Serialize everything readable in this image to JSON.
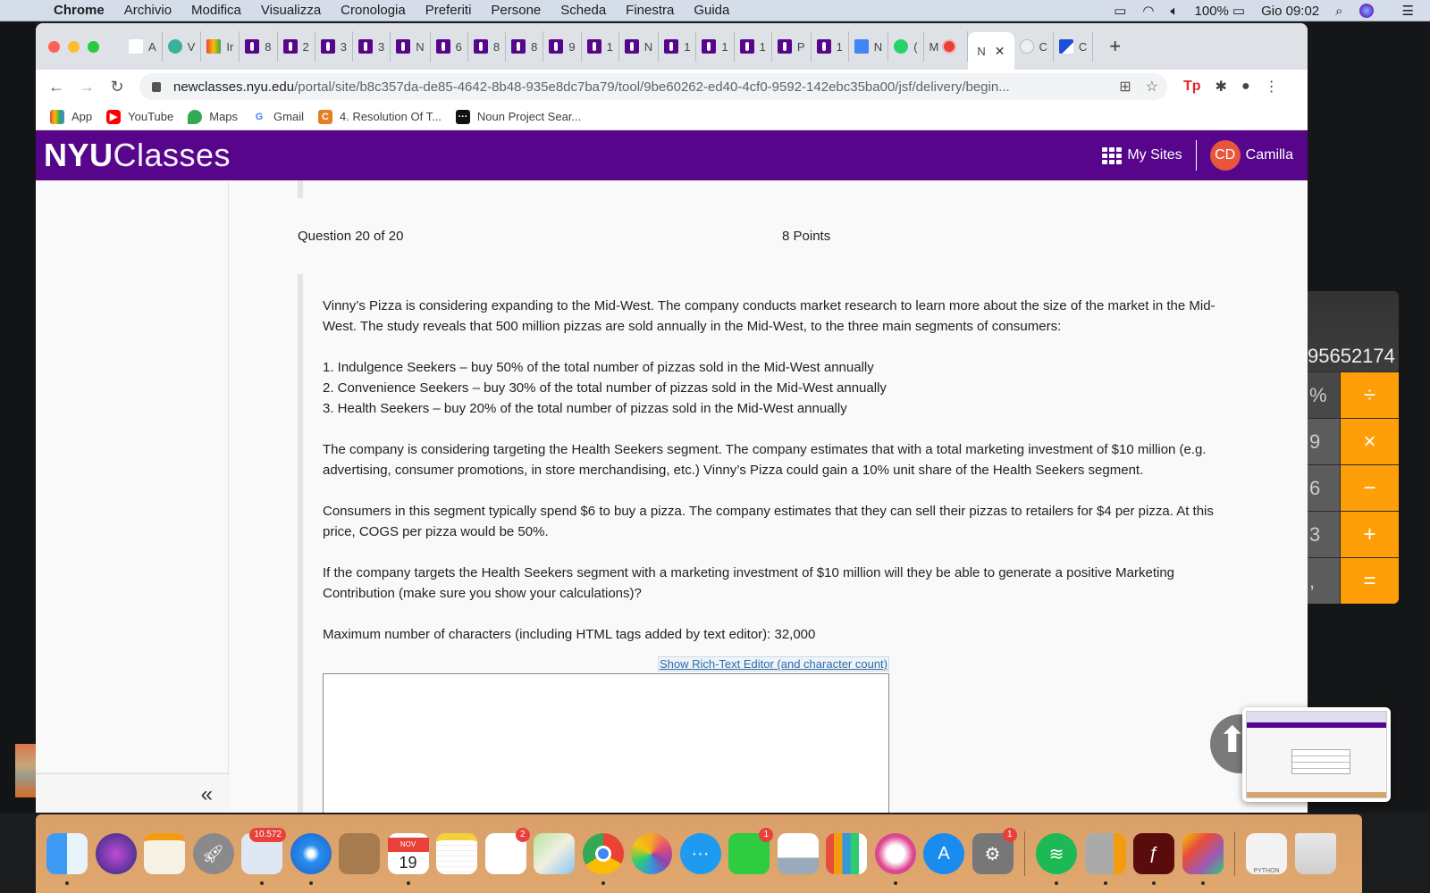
{
  "menubar": {
    "app": "Chrome",
    "items": [
      "Archivio",
      "Modifica",
      "Visualizza",
      "Cronologia",
      "Preferiti",
      "Persone",
      "Scheda",
      "Finestra",
      "Guida"
    ],
    "battery": "100%",
    "clock": "Gio 09:02"
  },
  "tabs": [
    {
      "label": "A",
      "icon": "shoe-icon"
    },
    {
      "label": "V",
      "icon": "play-icon"
    },
    {
      "label": "Ir",
      "icon": "gmail-icon"
    },
    {
      "label": "8",
      "icon": "nyu-torch-icon"
    },
    {
      "label": "2",
      "icon": "nyu-torch-icon"
    },
    {
      "label": "3",
      "icon": "nyu-torch-icon"
    },
    {
      "label": "3",
      "icon": "nyu-torch-icon"
    },
    {
      "label": "N",
      "icon": "nyu-torch-icon"
    },
    {
      "label": "6",
      "icon": "nyu-torch-icon"
    },
    {
      "label": "8",
      "icon": "nyu-torch-icon"
    },
    {
      "label": "8",
      "icon": "nyu-torch-icon"
    },
    {
      "label": "9",
      "icon": "nyu-torch-icon"
    },
    {
      "label": "1",
      "icon": "nyu-torch-icon"
    },
    {
      "label": "N",
      "icon": "nyu-torch-icon"
    },
    {
      "label": "1",
      "icon": "nyu-torch-icon"
    },
    {
      "label": "1",
      "icon": "nyu-torch-icon"
    },
    {
      "label": "1",
      "icon": "nyu-torch-icon"
    },
    {
      "label": "P",
      "icon": "nyu-torch-icon"
    },
    {
      "label": "1",
      "icon": "nyu-torch-icon"
    },
    {
      "label": "N",
      "icon": "docs-icon"
    },
    {
      "label": "(",
      "icon": "whatsapp-icon"
    },
    {
      "label": "M",
      "icon": "record-icon"
    },
    {
      "label": "N",
      "icon": "none",
      "active": true
    },
    {
      "label": "C",
      "icon": "extension-icon"
    },
    {
      "label": "C",
      "icon": "flag-icon"
    }
  ],
  "address": {
    "domain": "newclasses.nyu.edu",
    "path": "/portal/site/b8c357da-de85-4642-8b48-935e8dc7ba79/tool/9be60262-ed40-4cf0-9592-142ebc35ba00/jsf/delivery/begin..."
  },
  "bookmarks": [
    {
      "label": "App",
      "icon": "apps-grid-icon"
    },
    {
      "label": "YouTube",
      "icon": "youtube-icon"
    },
    {
      "label": "Maps",
      "icon": "maps-pin-icon"
    },
    {
      "label": "Gmail",
      "icon": "google-icon"
    },
    {
      "label": "4. Resolution Of T...",
      "icon": "c-logo-icon"
    },
    {
      "label": "Noun Project Sear...",
      "icon": "noun-project-icon"
    }
  ],
  "header": {
    "logo_bold": "NYU",
    "logo_light": "Classes",
    "my_sites": "My Sites",
    "avatar_initials": "CD",
    "user_name": "Camilla",
    "brand_color": "#57068c",
    "avatar_color": "#e8553c"
  },
  "question": {
    "number_label": "Question 20 of 20",
    "points_label": "8 Points",
    "intro": "Vinny’s Pizza is considering expanding to the Mid-West. The company conducts market research to learn more about the size of the market in the Mid-West. The study reveals that 500 million pizzas are sold annually in the Mid-West, to the three main segments of consumers:",
    "segments": [
      "1. Indulgence Seekers – buy 50% of the total number of pizzas sold in the Mid-West annually",
      "2. Convenience Seekers – buy 30% of the total number of pizzas sold in the Mid-West annually",
      "3. Health Seekers – buy 20% of the total number of pizzas sold in the Mid-West annually"
    ],
    "para2": "The company is considering targeting the Health Seekers segment. The company estimates that with a total marketing investment of $10 million (e.g. advertising, consumer promotions, in store merchandising, etc.) Vinny’s Pizza could gain a 10% unit share of the Health Seekers segment.",
    "para3": "Consumers in this segment typically spend $6 to buy a pizza. The company estimates that they can sell their pizzas to retailers for $4 per pizza. At this price, COGS per pizza would be 50%.",
    "para4": "If the company targets the Health Seekers segment with a marketing investment of $10 million will they be able to generate a positive Marketing Contribution (make sure you show your calculations)?",
    "max_chars": "Maximum number of characters (including HTML tags added by text editor): 32,000",
    "rte_link": "Show Rich-Text Editor (and character count)",
    "answer_value": ""
  },
  "sidebar": {
    "collapse_label": "«"
  },
  "calculator": {
    "display": "95652174",
    "keys": [
      {
        "left": "%",
        "op": "÷"
      },
      {
        "left": "9",
        "op": "×"
      },
      {
        "left": "6",
        "op": "−"
      },
      {
        "left": "3",
        "op": "+"
      },
      {
        "left": ",",
        "op": "="
      }
    ],
    "op_color": "#fe9f0a"
  },
  "dock": [
    {
      "name": "finder",
      "badge": null,
      "running": true
    },
    {
      "name": "siri",
      "badge": null,
      "running": false
    },
    {
      "name": "pages",
      "badge": null,
      "running": false
    },
    {
      "name": "launchpad",
      "badge": null,
      "running": false
    },
    {
      "name": "mail",
      "badge": "10.572",
      "running": true
    },
    {
      "name": "safari",
      "badge": null,
      "running": true
    },
    {
      "name": "contacts",
      "badge": null,
      "running": false
    },
    {
      "name": "calendar",
      "badge": null,
      "running": true,
      "month": "NOV",
      "day": "19"
    },
    {
      "name": "notes",
      "badge": null,
      "running": false
    },
    {
      "name": "reminders",
      "badge": "2",
      "running": false
    },
    {
      "name": "maps",
      "badge": null,
      "running": false
    },
    {
      "name": "chrome",
      "badge": null,
      "running": true
    },
    {
      "name": "photos",
      "badge": null,
      "running": false
    },
    {
      "name": "messages",
      "badge": null,
      "running": false
    },
    {
      "name": "facetime",
      "badge": "1",
      "running": false
    },
    {
      "name": "keynote",
      "badge": null,
      "running": false
    },
    {
      "name": "numbers",
      "badge": null,
      "running": false
    },
    {
      "name": "itunes",
      "badge": null,
      "running": true
    },
    {
      "name": "app-store",
      "badge": null,
      "running": false
    },
    {
      "name": "system-preferences",
      "badge": "1",
      "running": false
    },
    {
      "name": "spotify",
      "badge": null,
      "running": true
    },
    {
      "name": "calculator",
      "badge": null,
      "running": true
    },
    {
      "name": "flash",
      "badge": null,
      "running": true
    },
    {
      "name": "grapher",
      "badge": null,
      "running": true
    },
    {
      "name": "python-doc",
      "badge": null,
      "running": false,
      "label": "PYTHON"
    },
    {
      "name": "trash",
      "badge": null,
      "running": false
    }
  ]
}
